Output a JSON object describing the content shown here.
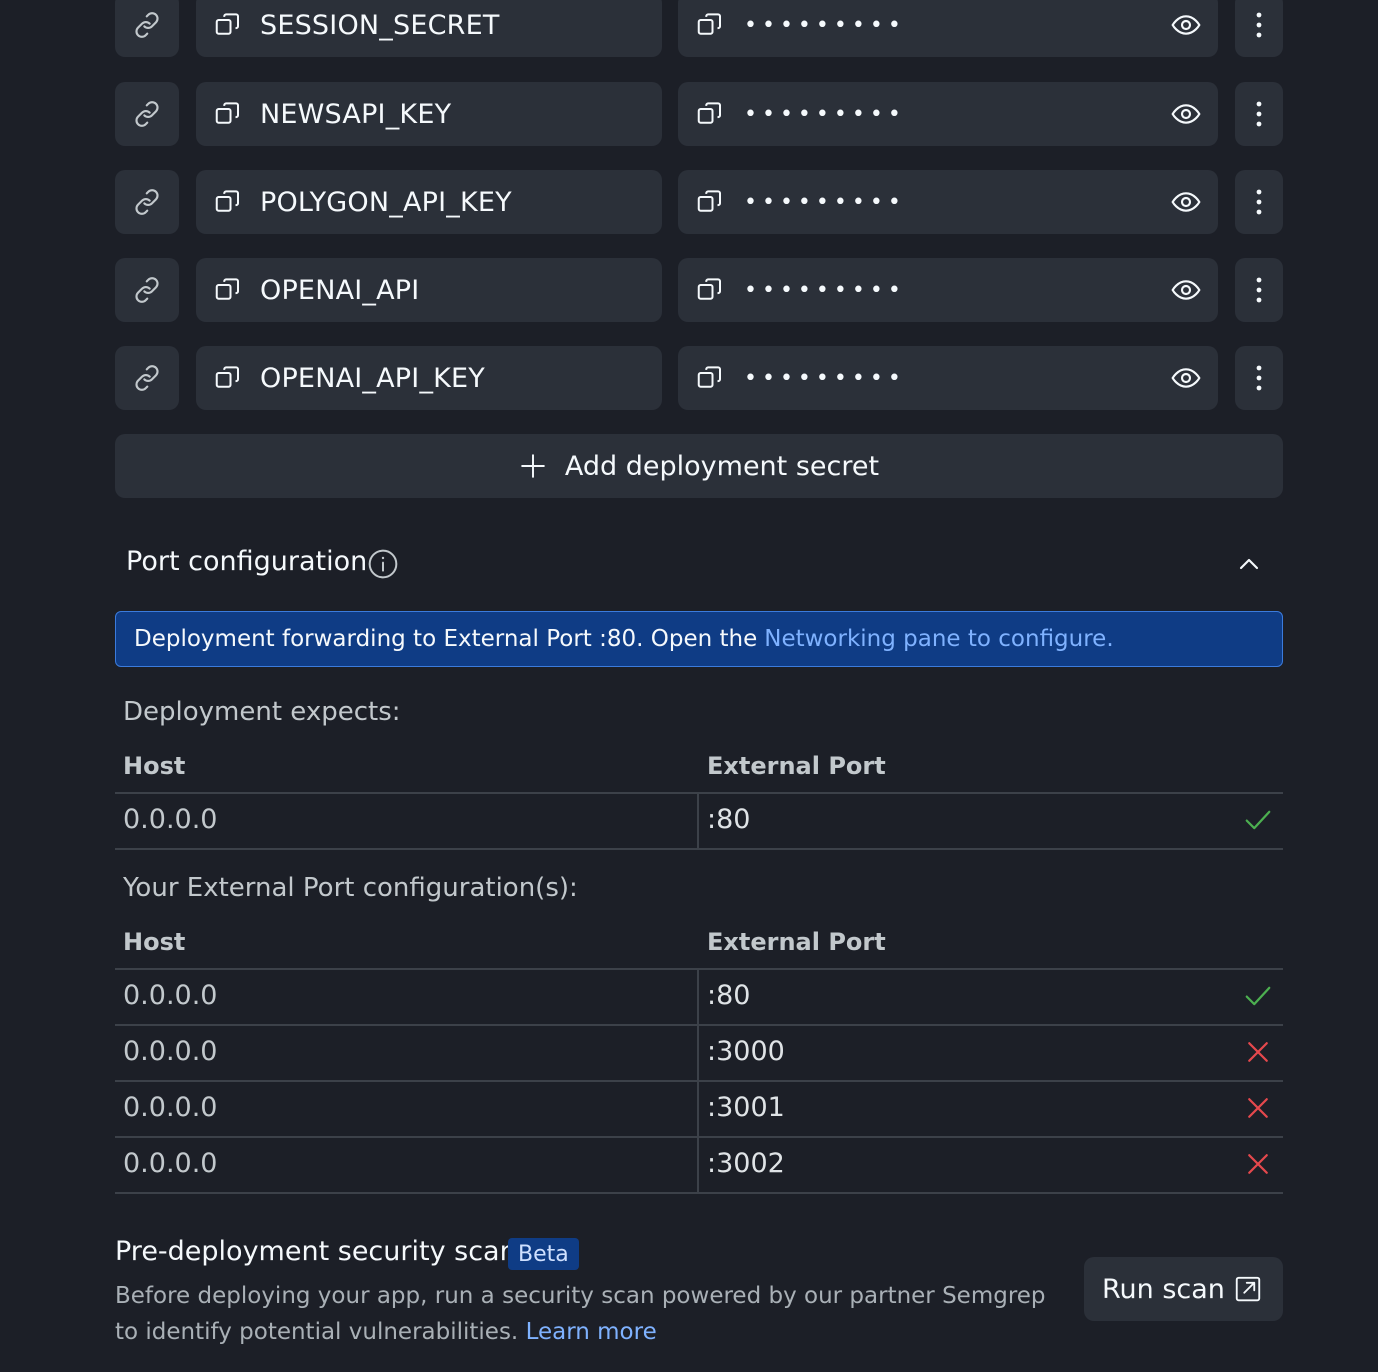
{
  "secrets": [
    {
      "key": "SESSION_SECRET",
      "value_mask": "•••••••••"
    },
    {
      "key": "NEWSAPI_KEY",
      "value_mask": "•••••••••"
    },
    {
      "key": "POLYGON_API_KEY",
      "value_mask": "•••••••••"
    },
    {
      "key": "OPENAI_API",
      "value_mask": "•••••••••"
    },
    {
      "key": "OPENAI_API_KEY",
      "value_mask": "•••••••••"
    }
  ],
  "add_secret_label": "Add deployment secret",
  "port_config": {
    "title": "Port configuration",
    "banner_text": "Deployment forwarding to External Port :80. Open the",
    "banner_link": "Networking pane to configure.",
    "expects_label": "Deployment expects:",
    "expects_table": {
      "headers": {
        "host": "Host",
        "port": "External Port"
      },
      "rows": [
        {
          "host": "0.0.0.0",
          "port": ":80",
          "status": "ok"
        }
      ]
    },
    "yours_label": "Your External Port configuration(s):",
    "yours_table": {
      "headers": {
        "host": "Host",
        "port": "External Port"
      },
      "rows": [
        {
          "host": "0.0.0.0",
          "port": ":80",
          "status": "ok"
        },
        {
          "host": "0.0.0.0",
          "port": ":3000",
          "status": "error"
        },
        {
          "host": "0.0.0.0",
          "port": ":3001",
          "status": "error"
        },
        {
          "host": "0.0.0.0",
          "port": ":3002",
          "status": "error"
        }
      ]
    }
  },
  "security_scan": {
    "title": "Pre-deployment security scan",
    "badge": "Beta",
    "description": "Before deploying your app, run a security scan powered by our partner Semgrep to identify potential vulnerabilities.",
    "learn_more": "Learn more",
    "run_button": "Run scan"
  },
  "colors": {
    "background": "#1c1f27",
    "surface": "#2b3039",
    "banner_bg": "#0f3c85",
    "link": "#7fb2ff",
    "ok_green": "#4caf50",
    "error_red": "#e5484d"
  },
  "icons": [
    "link-icon",
    "copy-icon",
    "eye-icon",
    "more-vertical-icon",
    "plus-icon",
    "info-icon",
    "chevron-up-icon",
    "check-icon",
    "x-icon",
    "external-link-icon"
  ]
}
